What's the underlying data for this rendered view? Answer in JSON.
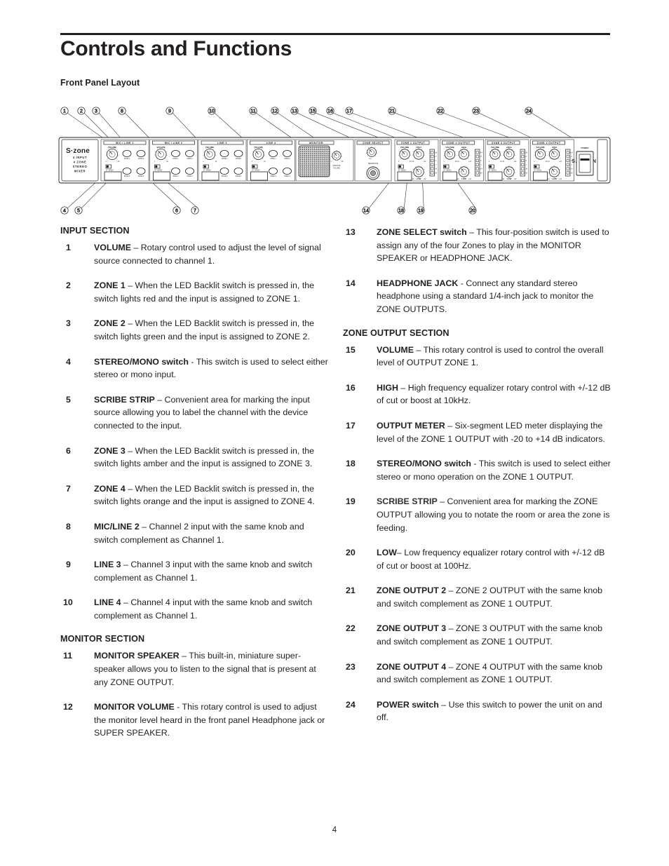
{
  "document": {
    "title": "Controls and Functions",
    "subtitle": "Front Panel Layout",
    "page_number": "4"
  },
  "diagram": {
    "name": "front-panel-layout-diagram",
    "device": {
      "logo_main": "S·zone",
      "logo_lines": [
        "4 INPUT",
        "4 ZONE",
        "STEREO",
        "MIXER"
      ],
      "brand": "SAMSON"
    },
    "channel_strips": [
      {
        "header": "MIC / LINE 1",
        "volume_label": "VOLUME",
        "scale_min": "1",
        "scale_max": "10",
        "zone_buttons": [
          "ZONE 1",
          "ZONE 2",
          "ZONE 3",
          "ZONE 4"
        ],
        "switch_labels": [
          "ST",
          "MONO"
        ]
      },
      {
        "header": "MIC / LINE 2",
        "volume_label": "VOLUME",
        "scale_min": "1",
        "scale_max": "10",
        "zone_buttons": [
          "ZONE 1",
          "ZONE 2",
          "ZONE 3",
          "ZONE 4"
        ],
        "switch_labels": [
          "ST",
          "MONO"
        ]
      },
      {
        "header": "LINE 3",
        "volume_label": "VOLUME",
        "scale_min": "1",
        "scale_max": "10",
        "zone_buttons": [
          "ZONE 1",
          "ZONE 2",
          "ZONE 3",
          "ZONE 4"
        ],
        "switch_labels": [
          "ST",
          "MONO"
        ]
      },
      {
        "header": "LINE 4",
        "volume_label": "VOLUME",
        "scale_min": "1",
        "scale_max": "10",
        "zone_buttons": [
          "ZONE 1",
          "ZONE 2",
          "ZONE 3",
          "ZONE 4"
        ],
        "switch_labels": [
          "ST",
          "MONO"
        ]
      }
    ],
    "monitor_section": {
      "header": "MONITOR",
      "volume_label": "MONITOR VOLUME",
      "scale_min": "1",
      "scale_max": "10"
    },
    "zone_select_section": {
      "header": "ZONE SELECT",
      "positions": [
        "1",
        "2",
        "3",
        "4"
      ],
      "headphone_label": "HEADPHONE"
    },
    "zone_output_strips": [
      {
        "header": "ZONE 1 OUTPUT",
        "volume_label": "VOLUME",
        "high_label": "HIGH",
        "low_label": "LOW",
        "eq_min": "-12",
        "eq_max": "+12",
        "scale_min": "1",
        "scale_max": "10",
        "switch_labels": [
          "ST",
          "MONO"
        ],
        "meter_labels": [
          "+14",
          "+7",
          "0",
          "-7",
          "-14",
          "-20"
        ]
      },
      {
        "header": "ZONE 2 OUTPUT",
        "volume_label": "VOLUME",
        "high_label": "HIGH",
        "low_label": "LOW",
        "eq_min": "-12",
        "eq_max": "+12",
        "scale_min": "1",
        "scale_max": "10",
        "switch_labels": [
          "ST",
          "MONO"
        ],
        "meter_labels": [
          "+14",
          "+7",
          "0",
          "-7",
          "-14",
          "-20"
        ]
      },
      {
        "header": "ZONE 3 OUTPUT",
        "volume_label": "VOLUME",
        "high_label": "HIGH",
        "low_label": "LOW",
        "eq_min": "-12",
        "eq_max": "+12",
        "scale_min": "1",
        "scale_max": "10",
        "switch_labels": [
          "ST",
          "MONO"
        ],
        "meter_labels": [
          "+14",
          "+7",
          "0",
          "-7",
          "-14",
          "-20"
        ]
      },
      {
        "header": "ZONE 4 OUTPUT",
        "volume_label": "VOLUME",
        "high_label": "HIGH",
        "low_label": "LOW",
        "eq_min": "-12",
        "eq_max": "+12",
        "scale_min": "1",
        "scale_max": "10",
        "switch_labels": [
          "ST",
          "MONO"
        ],
        "meter_labels": [
          "+14",
          "+7",
          "0",
          "-7",
          "-14",
          "-20"
        ]
      }
    ],
    "power_section": {
      "header": "POWER"
    },
    "callouts_top": [
      "1",
      "2",
      "3",
      "8",
      "9",
      "10",
      "11",
      "12",
      "13",
      "15",
      "16",
      "17",
      "21",
      "22",
      "23",
      "24"
    ],
    "callouts_bottom": [
      "4",
      "5",
      "6",
      "7",
      "14",
      "18",
      "19",
      "20"
    ]
  },
  "left_column": {
    "section1_head": "INPUT SECTION",
    "section2_head": "MONITOR SECTION",
    "items": [
      {
        "num": "1",
        "term": "VOLUME",
        "body": " – Rotary control used to adjust the level of signal source connected to channel 1."
      },
      {
        "num": "2",
        "term": "ZONE 1",
        "body": " – When the LED Backlit switch is pressed in, the switch lights red and the input is assigned to ZONE 1."
      },
      {
        "num": "3",
        "term": "ZONE 2",
        "body": " – When the LED Backlit switch is pressed in, the switch lights green and the input is assigned to ZONE 2."
      },
      {
        "num": "4",
        "term": "STEREO/MONO switch",
        "body": "  - This switch is used to select either stereo or mono input."
      },
      {
        "num": "5",
        "term": "SCRIBE STRIP",
        "body": " – Convenient area for marking the input source allowing you to label the channel with the device connected to the input."
      },
      {
        "num": "6",
        "term": "ZONE 3",
        "body": " – When the LED Backlit switch is pressed in, the switch lights amber and the input is assigned to ZONE 3."
      },
      {
        "num": "7",
        "term": "ZONE 4",
        "body": " – When the LED Backlit switch is pressed in, the switch lights orange and the input is assigned to ZONE 4."
      },
      {
        "num": "8",
        "term": "MIC/LINE 2",
        "body": " – Channel 2 input with the same knob and switch complement as Channel 1."
      },
      {
        "num": "9",
        "term": "LINE 3",
        "body": " – Channel 3 input with the same knob and switch complement as Channel 1."
      },
      {
        "num": "10",
        "term": "LINE 4",
        "body": " – Channel 4 input with the same knob and switch complement as Channel 1."
      }
    ],
    "monitor_items": [
      {
        "num": "11",
        "term": "MONITOR SPEAKER",
        "body": " – This built-in, miniature super-speaker allows you to listen to the signal that is present at any ZONE OUTPUT."
      },
      {
        "num": "12",
        "term": "MONITOR VOLUME",
        "body": "  - This rotary control is used to adjust the monitor level heard in the front panel Headphone jack or SUPER SPEAKER."
      }
    ]
  },
  "right_column": {
    "section_head": "ZONE OUTPUT SECTION",
    "items_top": [
      {
        "num": "13",
        "term": "ZONE SELECT switch",
        "body": " – This four-position switch is used to assign any of the four Zones to play in the MONITOR SPEAKER or HEADPHONE JACK."
      },
      {
        "num": "14",
        "term": " HEADPHONE JACK",
        "body": " - Connect any standard stereo headphone using a standard 1/4-inch jack to monitor the ZONE OUTPUTS."
      }
    ],
    "items_zone": [
      {
        "num": "15",
        "term": "VOLUME",
        "body": " – This rotary control is used to control the overall level of OUTPUT ZONE 1."
      },
      {
        "num": "16",
        "term": "HIGH",
        "body": " – High frequency equalizer rotary control with +/-12 dB of cut or boost at 10kHz."
      },
      {
        "num": "17",
        "term": "OUTPUT METER",
        "body": " – Six-segment LED meter displaying the level of the ZONE 1 OUTPUT with -20 to +14 dB indicators."
      },
      {
        "num": "18",
        "term": "STEREO/MONO switch",
        "body": "  - This switch is used to select either stereo or mono operation on the ZONE 1 OUTPUT."
      },
      {
        "num": "19",
        "term": "SCRIBE STRIP",
        "body": " – Convenient area for marking the ZONE OUTPUT allowing you to notate the room or area the zone is feeding."
      },
      {
        "num": "20",
        "term": "LOW",
        "body": "– Low frequency equalizer rotary control with +/-12 dB of cut or boost at 100Hz."
      },
      {
        "num": "21",
        "term": "ZONE OUTPUT 2",
        "body": " – ZONE 2 OUTPUT with the same knob and switch complement as ZONE 1 OUTPUT."
      },
      {
        "num": "22",
        "term": "ZONE OUTPUT 3",
        "body": " – ZONE 3 OUTPUT with the same knob and switch complement as ZONE 1 OUTPUT."
      },
      {
        "num": "23",
        "term": "ZONE OUTPUT 4",
        "body": " – ZONE 4 OUTPUT with the same knob and switch complement as ZONE 1 OUTPUT."
      },
      {
        "num": "24",
        "term": "POWER switch",
        "body": " – Use this switch to power the unit on and off."
      }
    ]
  }
}
